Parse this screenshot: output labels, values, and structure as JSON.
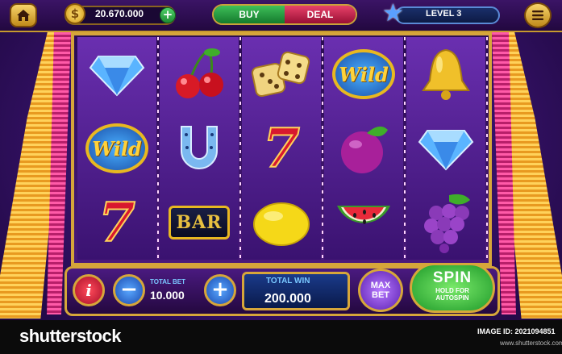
{
  "header": {
    "coins": "20.670.000",
    "buy_label": "BUY",
    "deal_label": "DEAL",
    "level_label": "LEVEL 3"
  },
  "reels": [
    [
      "diamond",
      "wild",
      "seven"
    ],
    [
      "cherries",
      "horseshoe",
      "bar"
    ],
    [
      "dice",
      "seven",
      "lemon"
    ],
    [
      "wild",
      "plum",
      "watermelon"
    ],
    [
      "bell",
      "diamond",
      "grapes"
    ]
  ],
  "symbols": {
    "wild_text": "Wild",
    "seven_text": "7",
    "bar_text": "BAR"
  },
  "controls": {
    "total_bet_label": "TOTAL BET",
    "total_bet_value": "10.000",
    "total_win_label": "TOTAL WIN",
    "total_win_value": "200.000",
    "max_bet_label": "MAX BET",
    "spin_label": "SPIN",
    "spin_sublabel": "HOLD FOR AUTOSPIN",
    "info_label": "i",
    "minus_label": "−",
    "plus_label": "+"
  },
  "footer": {
    "logo": "shutterstock",
    "image_id": "IMAGE ID: 2021094851",
    "site": "www.shutterstock.com"
  }
}
